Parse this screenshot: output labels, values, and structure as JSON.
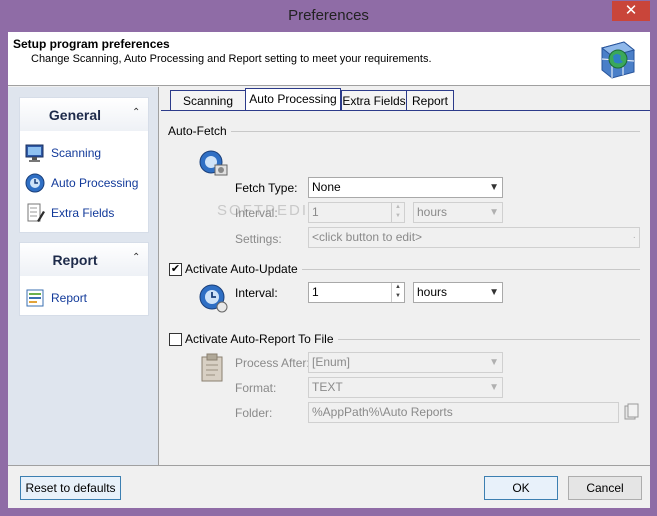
{
  "window": {
    "title": "Preferences",
    "close_glyph": "✕"
  },
  "header": {
    "title": "Setup program preferences",
    "subtitle": "Change Scanning, Auto Processing and Report setting to meet your requirements.",
    "icon": "globe-grid-icon"
  },
  "sidebar": {
    "groups": [
      {
        "title": "General",
        "items": [
          {
            "label": "Scanning",
            "icon": "monitor-icon"
          },
          {
            "label": "Auto Processing",
            "icon": "auto-process-icon"
          },
          {
            "label": "Extra Fields",
            "icon": "pencil-list-icon"
          }
        ]
      },
      {
        "title": "Report",
        "items": [
          {
            "label": "Report",
            "icon": "report-icon"
          }
        ]
      }
    ],
    "collapse_glyph": "⌃"
  },
  "tabs": [
    {
      "label": "Scanning",
      "active": false
    },
    {
      "label": "Auto Processing",
      "active": true
    },
    {
      "label": "Extra Fields",
      "active": false
    },
    {
      "label": "Report",
      "active": false
    }
  ],
  "auto_fetch": {
    "section": "Auto-Fetch",
    "fetch_type_label": "Fetch Type:",
    "fetch_type_value": "None",
    "interval_label": "Interval:",
    "interval_value": "1",
    "interval_unit": "hours",
    "settings_label": "Settings:",
    "settings_value": "<click button to edit>"
  },
  "auto_update": {
    "section": "Activate Auto-Update",
    "checked": true,
    "interval_label": "Interval:",
    "interval_value": "1",
    "interval_unit": "hours"
  },
  "auto_report": {
    "section": "Activate Auto-Report To File",
    "checked": false,
    "process_after_label": "Process After:",
    "process_after_value": "[Enum]",
    "format_label": "Format:",
    "format_value": "TEXT",
    "folder_label": "Folder:",
    "folder_value": "%AppPath%\\Auto Reports"
  },
  "footer": {
    "reset_label": "Reset to defaults",
    "ok_label": "OK",
    "cancel_label": "Cancel"
  }
}
